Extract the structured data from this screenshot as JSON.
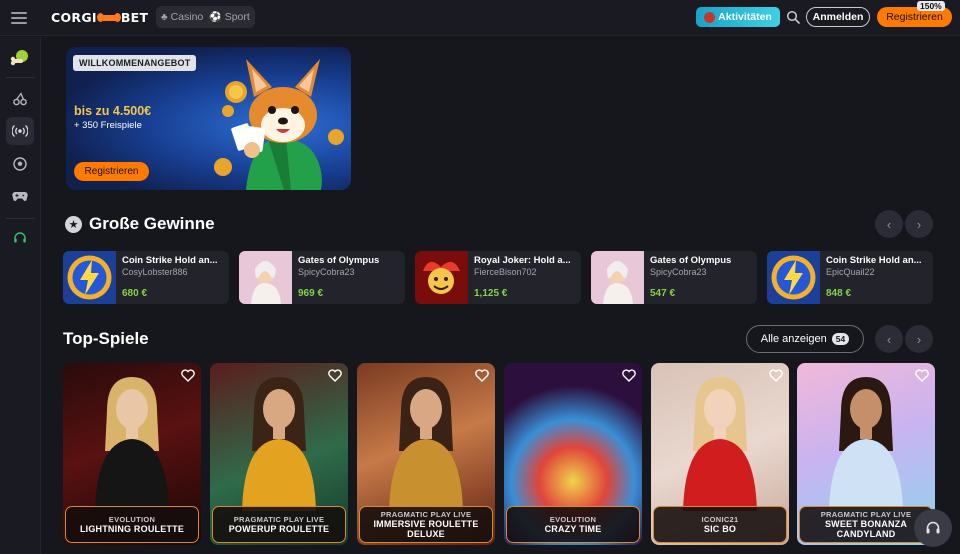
{
  "header": {
    "logo_left": "CORGI",
    "logo_right": "BET",
    "nav": [
      {
        "label": "Casino",
        "icon": "cherry-icon"
      },
      {
        "label": "Sport",
        "icon": "soccer-icon"
      }
    ],
    "activities_label": "Aktivitäten",
    "login_label": "Anmelden",
    "register_label": "Registrieren",
    "zoom": "150%",
    "accent": "#ff7a00"
  },
  "sidebar": {
    "items": [
      {
        "name": "menu-icon"
      },
      {
        "name": "bonus-bone-icon"
      },
      {
        "name": "casino-cherry-icon"
      },
      {
        "name": "live-broadcast-icon"
      },
      {
        "name": "sport-soccer-icon"
      },
      {
        "name": "esports-gamepad-icon"
      },
      {
        "name": "support-headset-icon"
      }
    ]
  },
  "promo": {
    "badge": "WILLKOMMENANGEBOT",
    "amount": "bis zu 4.500€",
    "spins": "+ 350 Freispiele",
    "button": "Registrieren"
  },
  "big_wins": {
    "title": "Große Gewinne",
    "items": [
      {
        "game": "Coin Strike Hold an...",
        "user": "CosyLobster886",
        "amount": "680 €",
        "thumb": "coin-strike"
      },
      {
        "game": "Gates of Olympus",
        "user": "SpicyCobra23",
        "amount": "969 €",
        "thumb": "olympus"
      },
      {
        "game": "Royal Joker: Hold a...",
        "user": "FierceBison702",
        "amount": "1,125 €",
        "thumb": "joker"
      },
      {
        "game": "Gates of Olympus",
        "user": "SpicyCobra23",
        "amount": "547 €",
        "thumb": "olympus"
      },
      {
        "game": "Coin Strike Hold an...",
        "user": "EpicQuail22",
        "amount": "848 €",
        "thumb": "coin-strike"
      }
    ]
  },
  "top_games": {
    "title": "Top-Spiele",
    "show_all": "Alle anzeigen",
    "count": "54",
    "items": [
      {
        "provider": "EVOLUTION",
        "name": "LIGHTNING ROULETTE"
      },
      {
        "provider": "PRAGMATIC PLAY LIVE",
        "name": "POWERUP ROULETTE"
      },
      {
        "provider": "PRAGMATIC PLAY LIVE",
        "name": "IMMERSIVE ROULETTE DELUXE"
      },
      {
        "provider": "EVOLUTION",
        "name": "CRAZY TIME"
      },
      {
        "provider": "ICONIC21",
        "name": "SIC BO"
      },
      {
        "provider": "PRAGMATIC PLAY LIVE",
        "name": "SWEET BONANZA CANDYLAND"
      }
    ]
  }
}
